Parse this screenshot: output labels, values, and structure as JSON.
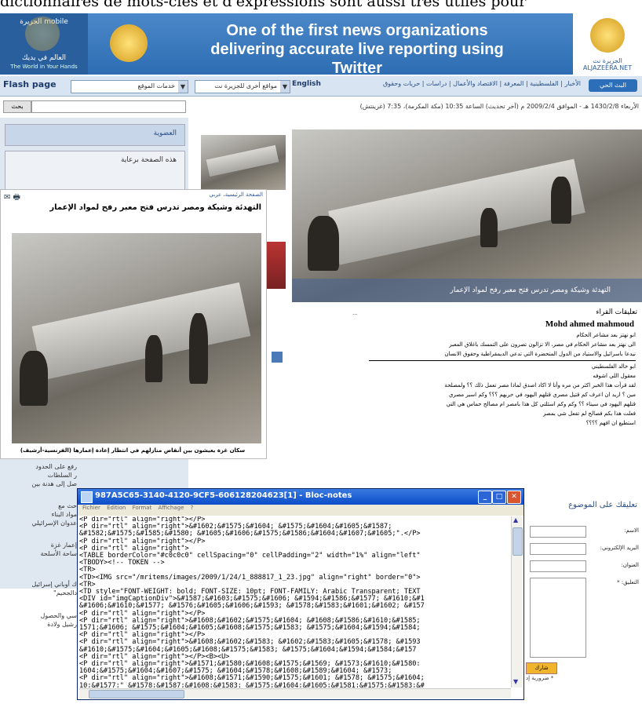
{
  "caption_fragment": "dictionnaires de mots-clés et d'expressions sont aussi très utiles pour",
  "banner": {
    "left_brand": "الجزيرة mobile",
    "left_tagline": "العالم في يديك",
    "left_english": "The World in Your Hands",
    "tagline": "One of the first news organizations delivering accurate live reporting using Twitter",
    "right_brand": "الجزيرة نت ALJAZEERA.NET"
  },
  "navbar": {
    "flash": "Flash page",
    "services_select": "خدمات الموقع",
    "sites_select": "مواقع أخرى للجزيرة نت",
    "english": "English",
    "links": "الأخبار | الفلسطينية | المعرفة | الاقتصاد والأعمال | دراسات | حريات وحقوق",
    "live_btn": "البث الحي"
  },
  "search": {
    "button": "بحث"
  },
  "dateline": "الأربعاء 1430/2/8 هـ - الموافق 2009/2/4 م (آخر تحديث) الساعة 10:35 (مكة المكرمة)، 7:35 (غرينتش)",
  "sidebar": {
    "membership": "العضوية",
    "sponsored": "هذه الصفحة برعاية"
  },
  "main_caption": "التهدئة وشيكة ومصر تدرس فتح معبر رفح لمواد الإعمار",
  "popup": {
    "breadcrumb": "الصفحة الرئيسية، عربي",
    "title": "التهدئة وشيكة ومصر تدرس فتح معبر رفح لمواد الإعمار",
    "photo_caption": "سكان غزة يعيشون بين أنقاض منازلهم في انتظار إعادة إعمارها (الفرنسية-أرشيف)"
  },
  "comments": {
    "header": "تعليقات القراء",
    "name": "Mohd ahmed mahmoud",
    "lines": [
      "انو نهتز بعد مشاعر الحكام",
      "الى نهتز بعد مشاعر الحكام في مصر، الا تزالون تصرون على التمسك باغلاق المعبر",
      "نيدعا باسرائيل والاستياد من الدول المتحضرة التي تدعي الديمقراطية وحقوق الانسان",
      "ابو خالد الفلسطيني",
      "معقول اللي اشوفه",
      "لقد قرأت هذا الخبر اكثر من مره وأنا لا اكاد اصدق لماذا مصر تعمل ذلك ؟؟ ولمصلحة",
      "مين ؟ اريد ان اعرف كم قتيل مصري قتلهم اليهود في حربهم ؟؟؟ وكم اسير مصري",
      "قتلهم اليهود في سيناء ؟؟ وكم وكم اسئلتي كل هذا بامصر ام مصالح حماس هي التي",
      "فعلت هذا بكم فصالح لم تفعل شي بمصر",
      "استطيع ان افهم ؟؟؟؟"
    ]
  },
  "comment_form": {
    "header": "تعليقك على الموضوع",
    "name_label": "الاسم:",
    "email_label": "البريد الإلكتروني:",
    "title_label": "العنوان:",
    "comment_label": "التعليق: *",
    "submit": "شارك",
    "note": "* ضرورية إد"
  },
  "left_fragments": [
    "رفع على الحدود",
    "ر السلطات",
    "صل إلى هدنة بين",
    "حث مع",
    "مواد البناء",
    "عدوان الإسرائيلي",
    "إعمار غزة",
    "ساحة الأسلحة",
    "ك أوباني إسرائيل",
    "دالجحيم\"",
    "سي والحصول",
    "رشيل ولادة"
  ],
  "notepad": {
    "title": "987A5C65-3140-4120-9CF5-606128204623[1] - Bloc-notes",
    "menu": [
      "Fichier",
      "Edition",
      "Format",
      "Affichage",
      "?"
    ],
    "lines": [
      "<P dir=\"rtl\" align=\"right\"></P>",
      "<P dir=\"rtl\" align=\"right\">&#1602;&#1575;&#1604; &#1575;&#1604;&#1605;&#1587;",
      "&#1582;&#1575;&#1585;&#1580; &#1605;&#1606;&#1575;&#1586;&#1604;&#1607;&#1605;\".</P>",
      "<P dir=\"rtl\" align=\"right\"></P>",
      "<P dir=\"rtl\" align=\"right\">",
      "<TABLE borderColor=\"#c0c0c0\" cellSpacing=\"0\" cellPadding=\"2\" width=\"1%\" align=\"left\"",
      "<TBODY><!-- TOKEN -->",
      "<TR>",
      "<TD><IMG src=\"/mritems/images/2009/1/24/1_888817_1_23.jpg\" align=\"right\" border=\"0\">",
      "<TR>",
      "<TD style=\"FONT-WEIGHT: bold; FONT-SIZE: 10pt; FONT-FAMILY: Arabic Transparent; TEXT",
      "<DIV id=\"imgCaptionDiv\">&#1587;&#1603;&#1575;&#1606; &#1594;&#1586;&#1577; &#1610;&#1",
      "&#1606;&#1610;&#1577; &#1576;&#1605;&#1606;&#1593; &#1578;&#1583;&#1601;&#1602; &#157",
      "<P dir=\"rtl\" align=\"right\"></P>",
      "<P dir=\"rtl\" align=\"right\">&#1608;&#1602;&#1575;&#1604; &#1608;&#1586;&#1610;&#1585;",
      "1571;&#1606; &#1575;&#1604;&#1605;&#1608;&#1575;&#1583; &#1575;&#1604;&#1594;&#1584;",
      "<P dir=\"rtl\" align=\"right\"></P>",
      "<P dir=\"rtl\" align=\"right\">&#1608;&#1602;&#1583; &#1602;&#1583;&#1605;&#1578; &#1593",
      "&#1610;&#1575;&#1604;&#1605;&#1608;&#1575;&#1583; &#1575;&#1604;&#1594;&#1584;&#157",
      "<P dir=\"rtl\" align=\"right\"></P><B><U>",
      "<P dir=\"rtl\" align=\"right\">&#1571;&#1580;&#1608;&#1575;&#1569; &#1573;&#1610;&#1580:",
      "1604;&#1575;&#1604;&#1607;&#1575; &#1604;&#1578;&#1608;&#1589;&#1604; &#1573;",
      "<P dir=\"rtl\" align=\"right\">&#1608;&#1571;&#1590;&#1575;&#1601; &#1578; &#1575;&#1604;",
      "10;&#1577;\" &#1578;&#1587;&#1608;&#1583; &#1575;&#1604;&#1605;&#1581;&#1575;&#1583;&#"
    ]
  }
}
